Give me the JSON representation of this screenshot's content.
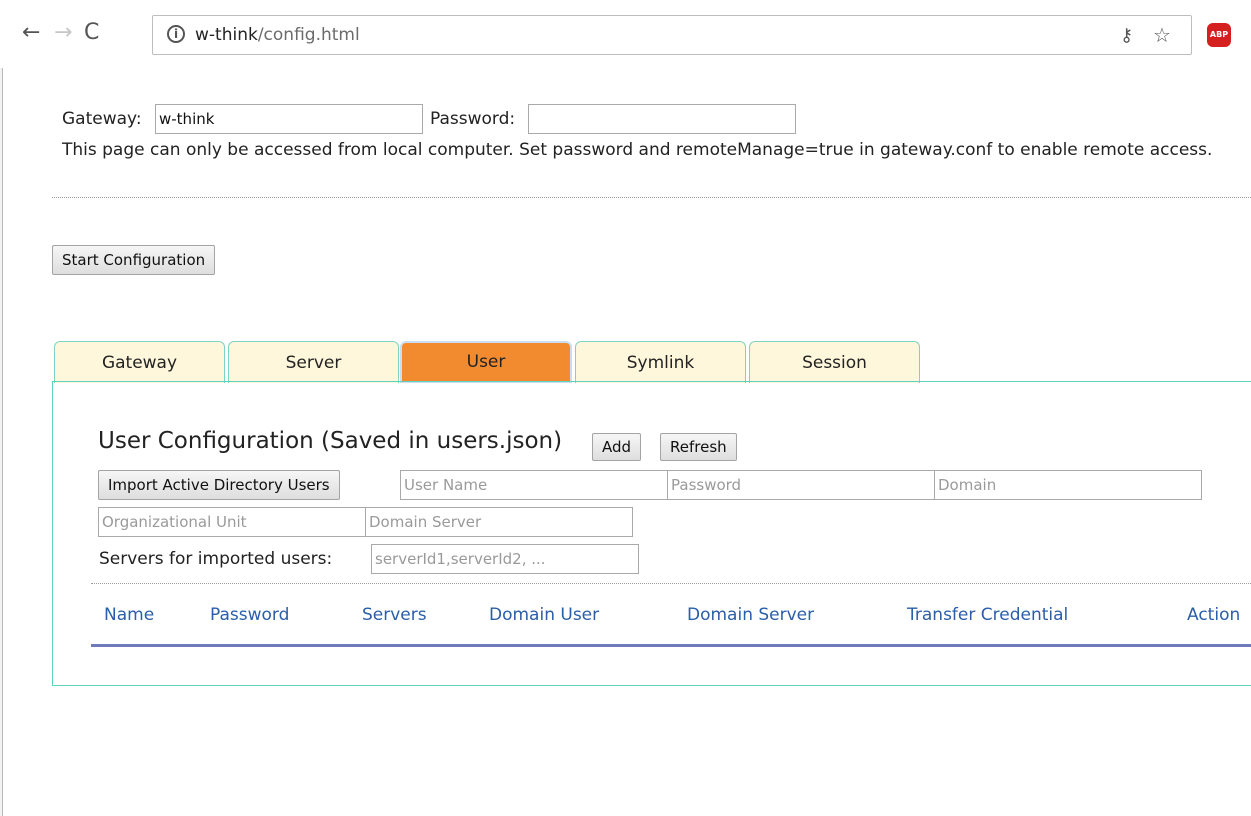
{
  "browser": {
    "url_host": "w-think",
    "url_path": "/config.html",
    "abp_label": "ABP"
  },
  "gateway": {
    "gateway_label": "Gateway:",
    "gateway_value": "w-think",
    "password_label": "Password:",
    "password_value": "",
    "note": "This page can only be accessed from local computer. Set password and remoteManage=true in gateway.conf to enable remote access."
  },
  "start_button": "Start Configuration",
  "tabs": [
    {
      "label": "Gateway",
      "active": false
    },
    {
      "label": "Server",
      "active": false
    },
    {
      "label": "User",
      "active": true
    },
    {
      "label": "Symlink",
      "active": false
    },
    {
      "label": "Session",
      "active": false
    }
  ],
  "user_config": {
    "title": "User Configuration (Saved in users.json)",
    "add_label": "Add",
    "refresh_label": "Refresh",
    "import_label": "Import Active Directory Users",
    "user_name_placeholder": "User Name",
    "password_placeholder": "Password",
    "domain_placeholder": "Domain",
    "ou_placeholder": "Organizational Unit",
    "domain_server_placeholder": "Domain Server",
    "servers_label": "Servers for imported users:",
    "servers_placeholder": "serverId1,serverId2, ..."
  },
  "table": {
    "columns": [
      "Name",
      "Password",
      "Servers",
      "Domain User",
      "Domain Server",
      "Transfer Credential",
      "Action"
    ],
    "rows": []
  },
  "colors": {
    "active_tab": "#f28a30",
    "tab_bg": "#fff7dc",
    "panel_border": "#62d0c0",
    "header_text": "#2a5ea9"
  }
}
